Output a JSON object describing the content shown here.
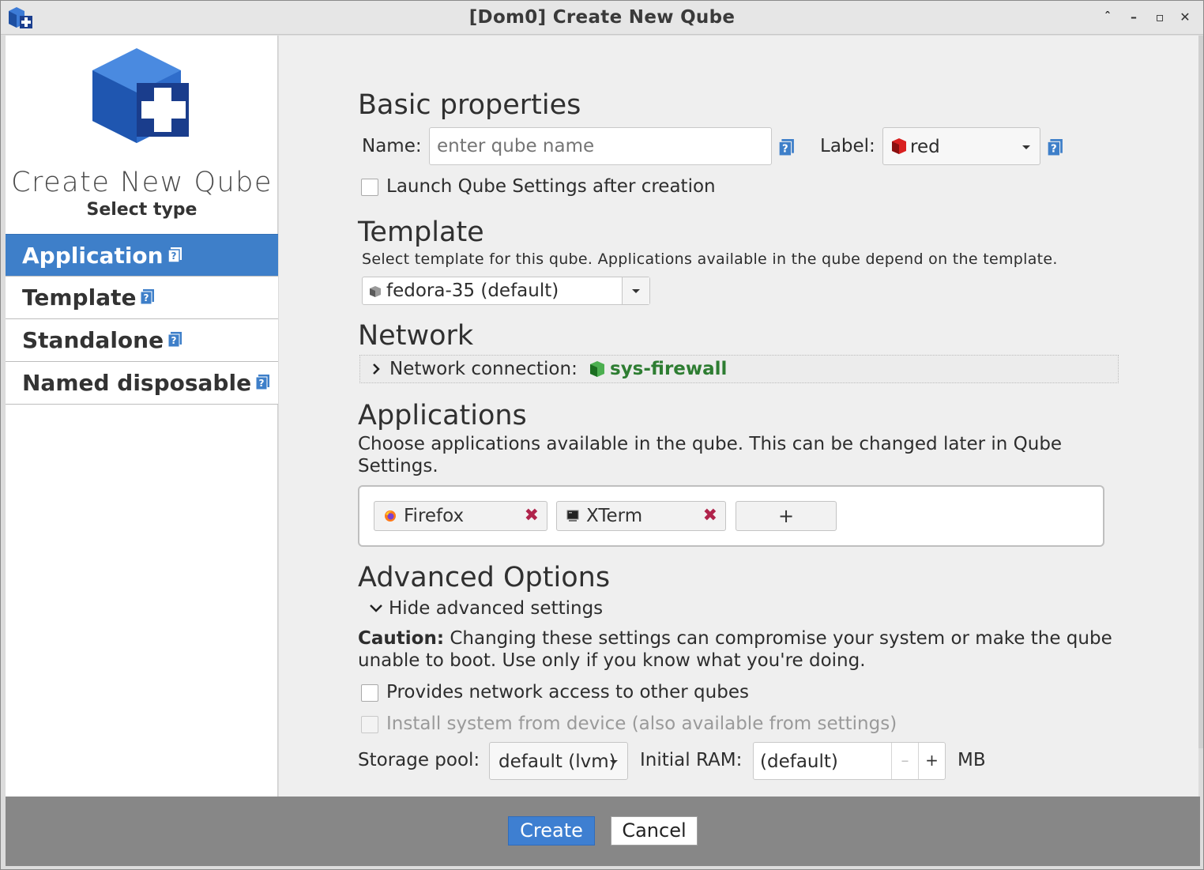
{
  "window": {
    "title": "[Dom0] Create New Qube",
    "controls": {
      "shade": "ˆ",
      "minimize": "–",
      "maximize": "▫",
      "close": "✕"
    }
  },
  "sidebar": {
    "heading": "Create New Qube",
    "subheading": "Select type",
    "types": [
      {
        "label": "Application",
        "selected": true
      },
      {
        "label": "Template",
        "selected": false
      },
      {
        "label": "Standalone",
        "selected": false
      },
      {
        "label": "Named disposable",
        "selected": false
      }
    ]
  },
  "basic": {
    "section_title": "Basic properties",
    "name_label": "Name:",
    "name_placeholder": "enter qube name",
    "label_label": "Label:",
    "label_value": "red",
    "label_color": "#cc1b1b",
    "launch_settings_label": "Launch Qube Settings after creation"
  },
  "template": {
    "section_title": "Template",
    "description": "Select template for this qube. Applications available in the qube depend on the template.",
    "selected": "fedora-35 (default)"
  },
  "network": {
    "section_title": "Network",
    "connection_label": "Network connection:",
    "connection_value": "sys-firewall",
    "connection_color": "#2e7d32"
  },
  "applications": {
    "section_title": "Applications",
    "description": "Choose applications available in the qube. This can be changed later in Qube Settings.",
    "items": [
      {
        "label": "Firefox",
        "icon": "firefox-icon"
      },
      {
        "label": "XTerm",
        "icon": "terminal-icon"
      }
    ],
    "add_label": "+"
  },
  "advanced": {
    "section_title": "Advanced Options",
    "toggle_label": "Hide advanced settings",
    "caution_bold": "Caution:",
    "caution_text": " Changing these settings can compromise your system or make the qube unable to boot. Use only if you know what you're doing.",
    "provides_network_label": "Provides network access to other qubes",
    "install_from_device_label": "Install system from device (also available from settings)",
    "storage_pool_label": "Storage pool:",
    "storage_pool_value": "default (lvm)",
    "initial_ram_label": "Initial RAM:",
    "initial_ram_value": "(default)",
    "ram_decrement": "–",
    "ram_increment": "+",
    "ram_unit": "MB"
  },
  "footer": {
    "create_label": "Create",
    "cancel_label": "Cancel"
  },
  "colors": {
    "accent": "#3e7fc9",
    "footer_bg": "#878787",
    "remove_x": "#b0234b"
  }
}
